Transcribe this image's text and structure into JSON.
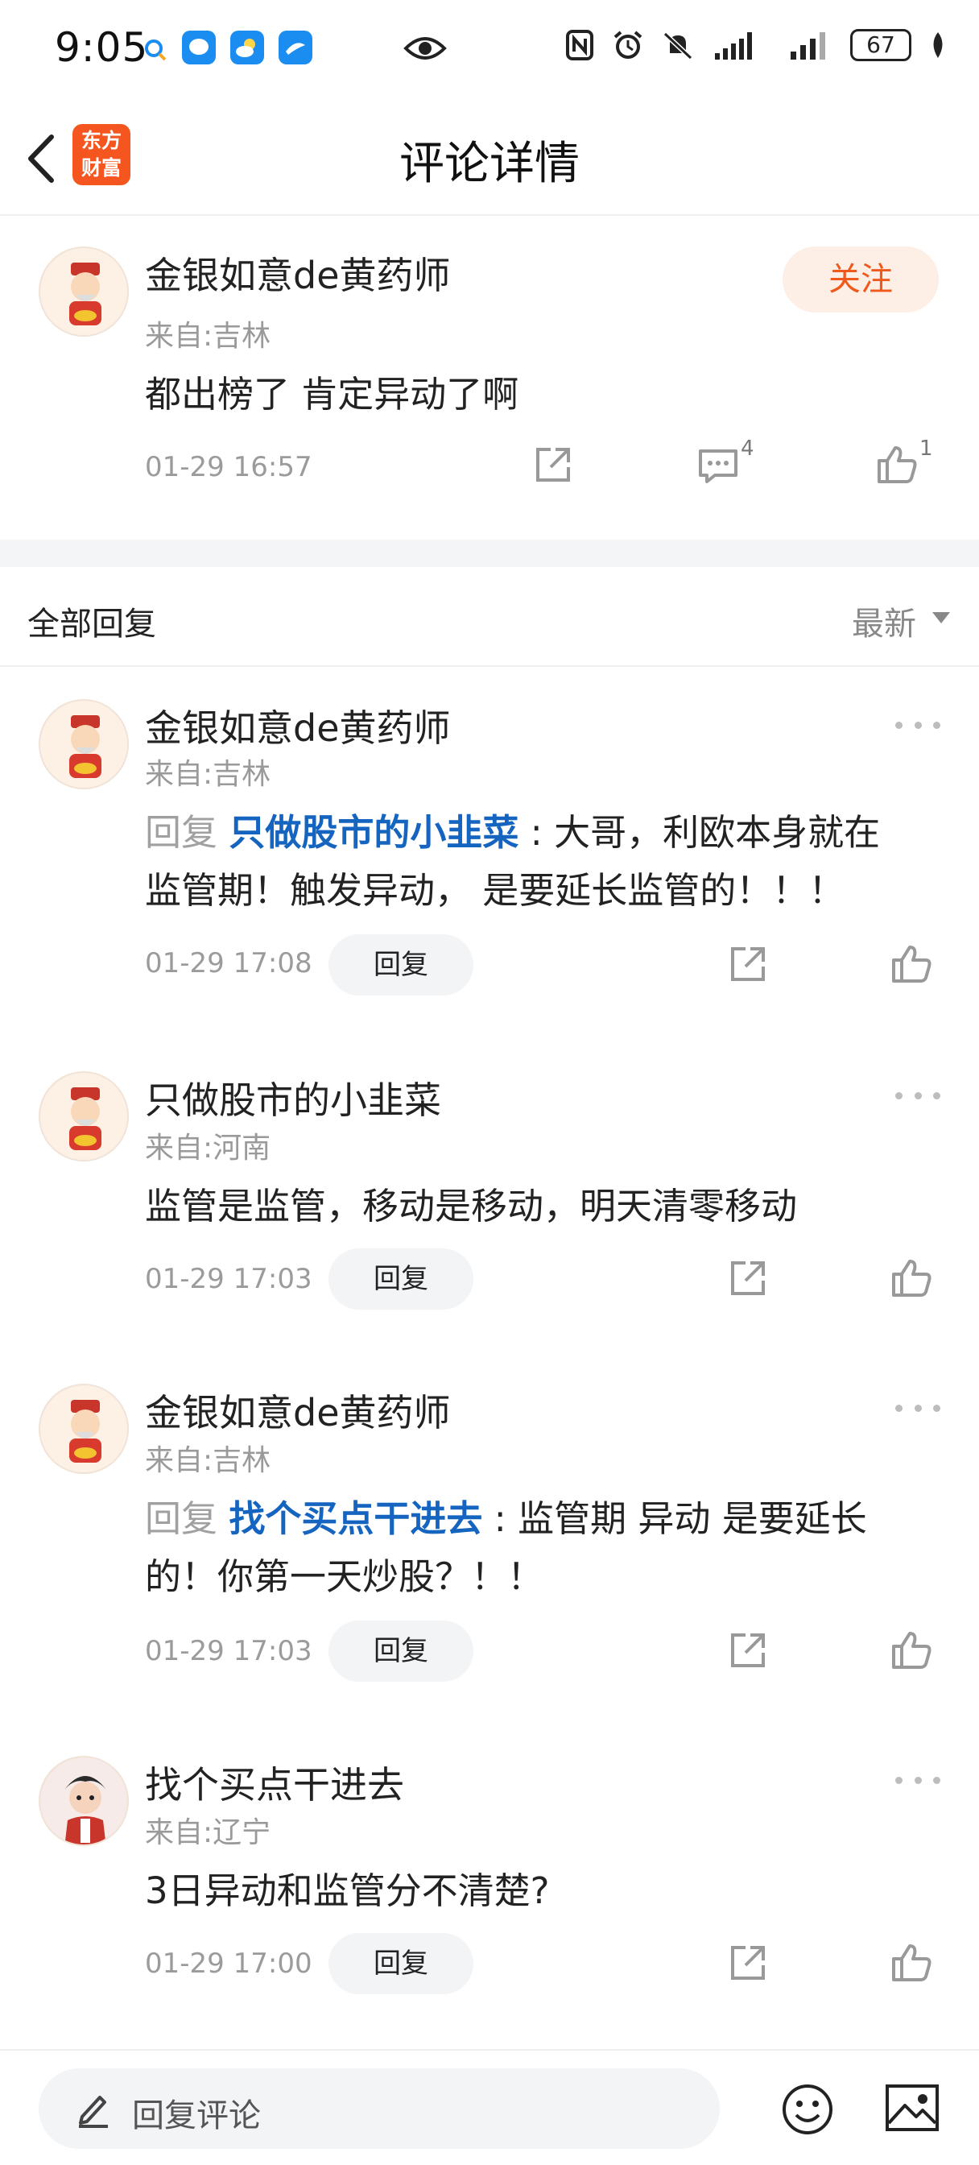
{
  "status_bar": {
    "time": "9:05",
    "battery": "67"
  },
  "header": {
    "title": "评论详情",
    "logo_line1": "东方",
    "logo_line2": "财富"
  },
  "main_comment": {
    "username": "金银如意de黄药师",
    "location": "来自:吉林",
    "follow_label": "关注",
    "content": "都出榜了 肯定异动了啊",
    "timestamp": "01-29 16:57",
    "comment_count": "4",
    "like_count": "1"
  },
  "replies_header": {
    "label": "全部回复",
    "sort": "最新"
  },
  "replies": [
    {
      "username": "金银如意de黄药师",
      "location": "来自:吉林",
      "reply_prefix": "回复 ",
      "reply_target": "只做股市的小韭菜",
      "content_line1": " : 大哥，利欧本身就在",
      "content_line2": "监管期！触发异动，  是要延长监管的！！！",
      "timestamp": "01-29 17:08",
      "reply_label": "回复"
    },
    {
      "username": "只做股市的小韭菜",
      "location": "来自:河南",
      "content_line1": "监管是监管，移动是移动，明天清零移动",
      "timestamp": "01-29 17:03",
      "reply_label": "回复"
    },
    {
      "username": "金银如意de黄药师",
      "location": "来自:吉林",
      "reply_prefix": "回复 ",
      "reply_target": "找个买点干进去",
      "content_line1": " : 监管期 异动 是要延长",
      "content_line2": "的！你第一天炒股？！！",
      "timestamp": "01-29 17:03",
      "reply_label": "回复"
    },
    {
      "username": "找个买点干进去",
      "location": "来自:辽宁",
      "content_line1": "3日异动和监管分不清楚?",
      "timestamp": "01-29 17:00",
      "reply_label": "回复"
    }
  ],
  "bottom_bar": {
    "placeholder": "回复评论"
  },
  "colors": {
    "accent": "#ef5a1c",
    "link": "#1565c0",
    "logo_bg": "#f5561f"
  }
}
